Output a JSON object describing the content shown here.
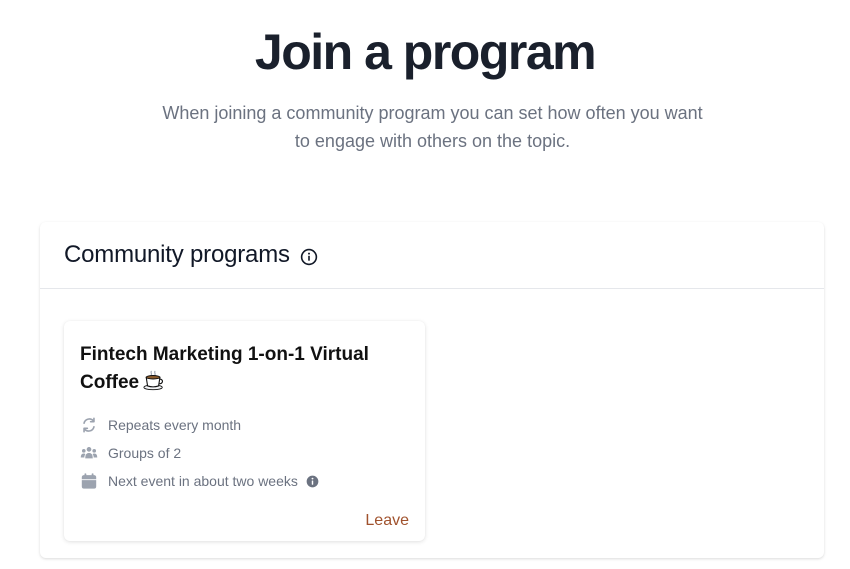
{
  "header": {
    "title": "Join a program",
    "subtitle": "When joining a community program you can set how often you want to engage with others on the topic."
  },
  "community_programs": {
    "title": "Community programs",
    "info_icon": "info-circle-icon",
    "programs": [
      {
        "title": "Fintech Marketing 1-on-1 Virtual Coffee",
        "title_icon": "coffee-icon",
        "repeats": "Repeats every month",
        "repeats_icon": "repeat-icon",
        "groups": "Groups of 2",
        "groups_icon": "users-icon",
        "next_event": "Next event in about two weeks",
        "next_event_icon": "calendar-icon",
        "action_label": "Leave"
      }
    ]
  },
  "colors": {
    "title": "#1a202c",
    "muted_text": "#6b7280",
    "icon_gray": "#9ca3af",
    "leave_link": "#a0522d",
    "divider": "#e5e7eb"
  }
}
